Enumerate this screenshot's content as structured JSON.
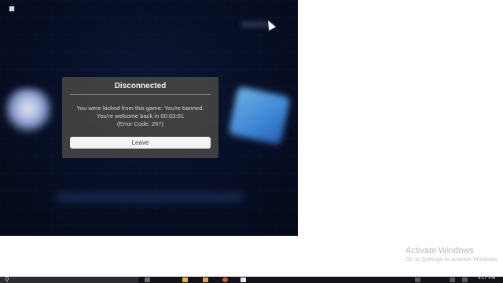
{
  "dialog": {
    "title": "Disconnected",
    "message_line1": "You were kicked from this game: You're banned.",
    "message_line2": "You're welcome back in 00:03:01",
    "message_line3": "(Error Code: 267)",
    "leave_label": "Leave"
  },
  "watermark": {
    "title": "Activate Windows",
    "subtitle": "Go to Settings to activate Windows."
  },
  "taskbar": {
    "clock": "9:17 PM"
  },
  "colors": {
    "dialog_bg": "#424242",
    "button_bg": "#f4f4f4",
    "game_bg": "#081027"
  },
  "icons": {
    "game_menu": "roblox-menu-icon",
    "search": "search-icon",
    "file_explorer": "folder-icon",
    "store": "store-icon",
    "browser": "browser-icon"
  }
}
